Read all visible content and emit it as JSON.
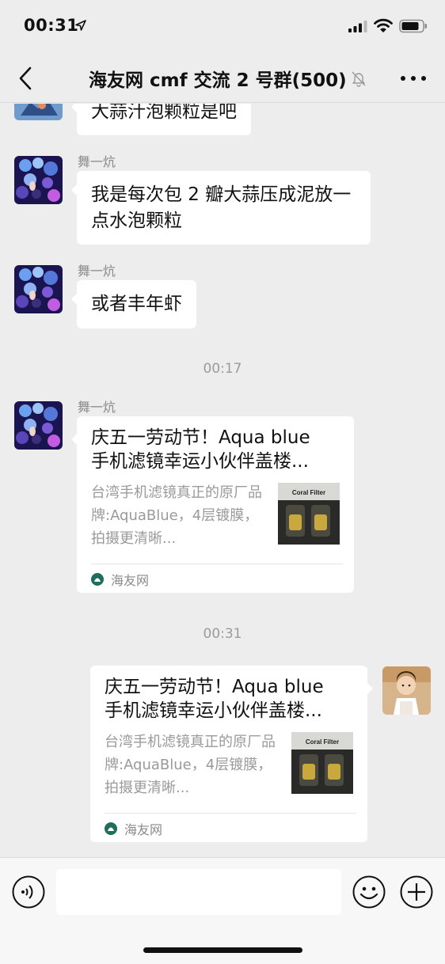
{
  "status_bar": {
    "time": "00:31",
    "location_icon": "location-arrow-icon",
    "signal_icon": "cellular-signal-icon",
    "wifi_icon": "wifi-icon",
    "battery_icon": "battery-icon"
  },
  "nav": {
    "back_icon": "chevron-left-icon",
    "title": "海友网 cmf 交流 2 号群(500)",
    "mute_icon": "bell-muted-icon",
    "more_icon": "more-dots-icon"
  },
  "messages": [
    {
      "type": "text",
      "side": "left",
      "text": "大蒜汁泡颗粒是吧"
    },
    {
      "type": "text",
      "side": "left",
      "sender": "舞一炕",
      "text": "我是每次包 2 瓣大蒜压成泥放一点水泡颗粒"
    },
    {
      "type": "text",
      "side": "left",
      "sender": "舞一炕",
      "text": "或者丰年虾"
    }
  ],
  "timestamps": [
    "00:17",
    "00:31"
  ],
  "cards": [
    {
      "side": "left",
      "sender": "舞一炕",
      "title_line1": "庆五一劳动节！Aqua blue",
      "title_line2": "手机滤镜幸运小伙伴盖楼...",
      "desc": "台湾手机滤镜真正的原厂品牌:AquaBlue，4层镀膜，拍摄更清晰...",
      "thumb_label": "Coral Filter",
      "source": "海友网"
    },
    {
      "side": "right",
      "title_line1": "庆五一劳动节！Aqua blue",
      "title_line2": "手机滤镜幸运小伙伴盖楼...",
      "desc": "台湾手机滤镜真正的原厂品牌:AquaBlue，4层镀膜，拍摄更清晰...",
      "thumb_label": "Coral Filter",
      "source": "海友网"
    }
  ],
  "input_bar": {
    "voice_icon": "voice-icon",
    "input_value": "",
    "emoji_icon": "emoji-icon",
    "plus_icon": "plus-circle-icon"
  },
  "colors": {
    "background": "#ededed",
    "bubble": "#ffffff",
    "meta_text": "#8a8a8a",
    "source_icon": "#1f6d5b"
  }
}
